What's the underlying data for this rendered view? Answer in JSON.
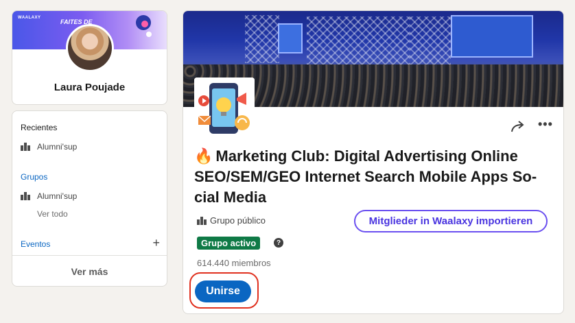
{
  "profile": {
    "banner_brand": "WAALAXY",
    "banner_slogan": "FAITES DE",
    "name": "Laura Poujade"
  },
  "nav": {
    "recent_heading": "Recientes",
    "recent_items": [
      {
        "label": "Alumni'sup",
        "icon": "building-icon"
      }
    ],
    "groups_heading": "Grupos",
    "group_items": [
      {
        "label": "Alumni'sup",
        "icon": "building-icon"
      }
    ],
    "see_all": "Ver todo",
    "events_heading": "Eventos",
    "events_add_icon": "+",
    "more_label": "Ver más"
  },
  "group": {
    "title_emoji": "🔥",
    "title": "Marketing Club: Digital Advertising Online SEO/SEM/GEO Internet Search Mobile Apps So-cial Media",
    "privacy": "Grupo público",
    "active_badge": "Grupo activo",
    "members": "614.440 miembros",
    "join_label": "Unirse",
    "import_label": "Mitglieder in Waalaxy importieren",
    "more_icon_glyph": "•••",
    "help_icon_glyph": "?"
  },
  "colors": {
    "linkedin_blue": "#0a66c2",
    "active_green": "#0f7a46",
    "waalaxy_purple": "#6a4ff0",
    "highlight_red": "#e0301e",
    "page_bg": "#f4f2ee"
  }
}
